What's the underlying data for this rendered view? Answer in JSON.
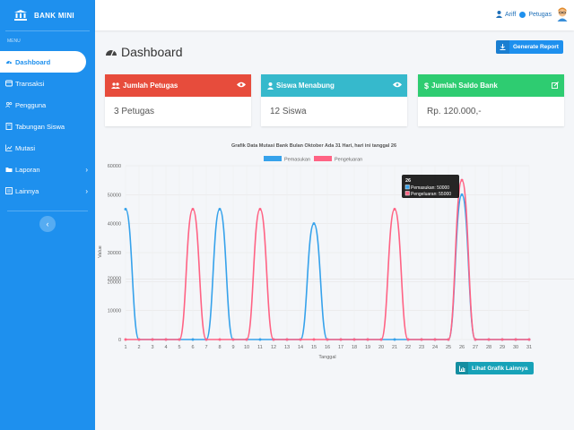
{
  "brand": {
    "name": "BANK MINI",
    "icon": "bank-icon"
  },
  "sidebar": {
    "heading": "MENU",
    "items": [
      {
        "label": "Dashboard",
        "icon": "gauge-icon",
        "active": true,
        "submenu": false
      },
      {
        "label": "Transaksi",
        "icon": "exchange-icon",
        "active": false,
        "submenu": false
      },
      {
        "label": "Pengguna",
        "icon": "users-icon",
        "active": false,
        "submenu": false
      },
      {
        "label": "Tabungan Siswa",
        "icon": "book-icon",
        "active": false,
        "submenu": false
      },
      {
        "label": "Mutasi",
        "icon": "chart-icon",
        "active": false,
        "submenu": false
      },
      {
        "label": "Laporan",
        "icon": "folder-icon",
        "active": false,
        "submenu": true
      },
      {
        "label": "Lainnya",
        "icon": "list-icon",
        "active": false,
        "submenu": true
      }
    ],
    "collapse_glyph": "‹"
  },
  "topbar": {
    "username": "Ariff",
    "role": "Petugas"
  },
  "header": {
    "title": "Dashboard",
    "generate_label": "Generate Report"
  },
  "cards": [
    {
      "title": "Jumlah Petugas",
      "value": "3 Petugas",
      "color": "#e74c3c",
      "icon": "users-icon",
      "action_icon": "eye-icon"
    },
    {
      "title": "Siswa Menabung",
      "value": "12 Siswa",
      "color": "#36b9cc",
      "icon": "user-icon",
      "action_icon": "eye-icon"
    },
    {
      "title": "Jumlah Saldo Bank",
      "value": "Rp. 120.000,-",
      "color": "#2ecc71",
      "icon": "dollar-icon",
      "action_icon": "edit-icon"
    }
  ],
  "chart_data": {
    "type": "line",
    "title": "Grafik Data Mutasi Bank Bulan Oktober Ada 31 Hari, hari ini tanggal 26",
    "xlabel": "Tanggal",
    "ylabel": "Value",
    "ylim": [
      0,
      60000
    ],
    "yticks": [
      0,
      10000,
      20000,
      30000,
      40000,
      50000,
      60000
    ],
    "extra_tick": 20000,
    "x": [
      1,
      2,
      3,
      4,
      5,
      6,
      7,
      8,
      9,
      10,
      11,
      12,
      13,
      14,
      15,
      16,
      17,
      18,
      19,
      20,
      21,
      22,
      23,
      24,
      25,
      26,
      27,
      28,
      29,
      30,
      31
    ],
    "series": [
      {
        "name": "Pemasukan",
        "color": "#36a2eb",
        "values": [
          45000,
          0,
          0,
          0,
          0,
          0,
          0,
          45000,
          0,
          0,
          0,
          0,
          0,
          0,
          40000,
          0,
          0,
          0,
          0,
          0,
          0,
          0,
          0,
          0,
          0,
          50000,
          0,
          0,
          0,
          0,
          0
        ]
      },
      {
        "name": "Pengeluaran",
        "color": "#ff6384",
        "values": [
          0,
          0,
          0,
          0,
          0,
          45000,
          0,
          0,
          0,
          0,
          45000,
          0,
          0,
          0,
          0,
          0,
          0,
          0,
          0,
          0,
          45000,
          0,
          0,
          0,
          0,
          55000,
          0,
          0,
          0,
          0,
          0
        ]
      }
    ],
    "legend_position": "top",
    "grid": true,
    "tooltip": {
      "title": "26",
      "lines": [
        "Pemasukan: 50000",
        "Pengeluaran: 55000"
      ]
    }
  },
  "footer": {
    "lihat_label": "Lihat Grafik Lainnya"
  }
}
